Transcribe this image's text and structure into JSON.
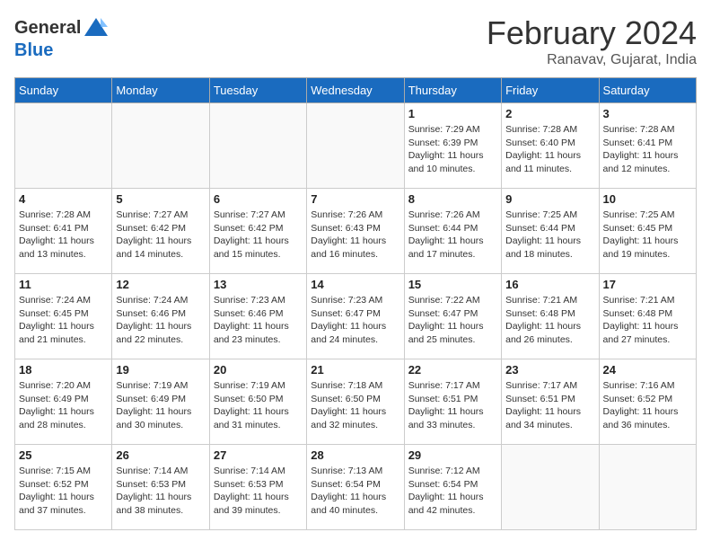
{
  "header": {
    "logo_general": "General",
    "logo_blue": "Blue",
    "title": "February 2024",
    "subtitle": "Ranavav, Gujarat, India"
  },
  "days_of_week": [
    "Sunday",
    "Monday",
    "Tuesday",
    "Wednesday",
    "Thursday",
    "Friday",
    "Saturday"
  ],
  "weeks": [
    [
      {
        "day": "",
        "info": ""
      },
      {
        "day": "",
        "info": ""
      },
      {
        "day": "",
        "info": ""
      },
      {
        "day": "",
        "info": ""
      },
      {
        "day": "1",
        "info": "Sunrise: 7:29 AM\nSunset: 6:39 PM\nDaylight: 11 hours and 10 minutes."
      },
      {
        "day": "2",
        "info": "Sunrise: 7:28 AM\nSunset: 6:40 PM\nDaylight: 11 hours and 11 minutes."
      },
      {
        "day": "3",
        "info": "Sunrise: 7:28 AM\nSunset: 6:41 PM\nDaylight: 11 hours and 12 minutes."
      }
    ],
    [
      {
        "day": "4",
        "info": "Sunrise: 7:28 AM\nSunset: 6:41 PM\nDaylight: 11 hours and 13 minutes."
      },
      {
        "day": "5",
        "info": "Sunrise: 7:27 AM\nSunset: 6:42 PM\nDaylight: 11 hours and 14 minutes."
      },
      {
        "day": "6",
        "info": "Sunrise: 7:27 AM\nSunset: 6:42 PM\nDaylight: 11 hours and 15 minutes."
      },
      {
        "day": "7",
        "info": "Sunrise: 7:26 AM\nSunset: 6:43 PM\nDaylight: 11 hours and 16 minutes."
      },
      {
        "day": "8",
        "info": "Sunrise: 7:26 AM\nSunset: 6:44 PM\nDaylight: 11 hours and 17 minutes."
      },
      {
        "day": "9",
        "info": "Sunrise: 7:25 AM\nSunset: 6:44 PM\nDaylight: 11 hours and 18 minutes."
      },
      {
        "day": "10",
        "info": "Sunrise: 7:25 AM\nSunset: 6:45 PM\nDaylight: 11 hours and 19 minutes."
      }
    ],
    [
      {
        "day": "11",
        "info": "Sunrise: 7:24 AM\nSunset: 6:45 PM\nDaylight: 11 hours and 21 minutes."
      },
      {
        "day": "12",
        "info": "Sunrise: 7:24 AM\nSunset: 6:46 PM\nDaylight: 11 hours and 22 minutes."
      },
      {
        "day": "13",
        "info": "Sunrise: 7:23 AM\nSunset: 6:46 PM\nDaylight: 11 hours and 23 minutes."
      },
      {
        "day": "14",
        "info": "Sunrise: 7:23 AM\nSunset: 6:47 PM\nDaylight: 11 hours and 24 minutes."
      },
      {
        "day": "15",
        "info": "Sunrise: 7:22 AM\nSunset: 6:47 PM\nDaylight: 11 hours and 25 minutes."
      },
      {
        "day": "16",
        "info": "Sunrise: 7:21 AM\nSunset: 6:48 PM\nDaylight: 11 hours and 26 minutes."
      },
      {
        "day": "17",
        "info": "Sunrise: 7:21 AM\nSunset: 6:48 PM\nDaylight: 11 hours and 27 minutes."
      }
    ],
    [
      {
        "day": "18",
        "info": "Sunrise: 7:20 AM\nSunset: 6:49 PM\nDaylight: 11 hours and 28 minutes."
      },
      {
        "day": "19",
        "info": "Sunrise: 7:19 AM\nSunset: 6:49 PM\nDaylight: 11 hours and 30 minutes."
      },
      {
        "day": "20",
        "info": "Sunrise: 7:19 AM\nSunset: 6:50 PM\nDaylight: 11 hours and 31 minutes."
      },
      {
        "day": "21",
        "info": "Sunrise: 7:18 AM\nSunset: 6:50 PM\nDaylight: 11 hours and 32 minutes."
      },
      {
        "day": "22",
        "info": "Sunrise: 7:17 AM\nSunset: 6:51 PM\nDaylight: 11 hours and 33 minutes."
      },
      {
        "day": "23",
        "info": "Sunrise: 7:17 AM\nSunset: 6:51 PM\nDaylight: 11 hours and 34 minutes."
      },
      {
        "day": "24",
        "info": "Sunrise: 7:16 AM\nSunset: 6:52 PM\nDaylight: 11 hours and 36 minutes."
      }
    ],
    [
      {
        "day": "25",
        "info": "Sunrise: 7:15 AM\nSunset: 6:52 PM\nDaylight: 11 hours and 37 minutes."
      },
      {
        "day": "26",
        "info": "Sunrise: 7:14 AM\nSunset: 6:53 PM\nDaylight: 11 hours and 38 minutes."
      },
      {
        "day": "27",
        "info": "Sunrise: 7:14 AM\nSunset: 6:53 PM\nDaylight: 11 hours and 39 minutes."
      },
      {
        "day": "28",
        "info": "Sunrise: 7:13 AM\nSunset: 6:54 PM\nDaylight: 11 hours and 40 minutes."
      },
      {
        "day": "29",
        "info": "Sunrise: 7:12 AM\nSunset: 6:54 PM\nDaylight: 11 hours and 42 minutes."
      },
      {
        "day": "",
        "info": ""
      },
      {
        "day": "",
        "info": ""
      }
    ]
  ]
}
